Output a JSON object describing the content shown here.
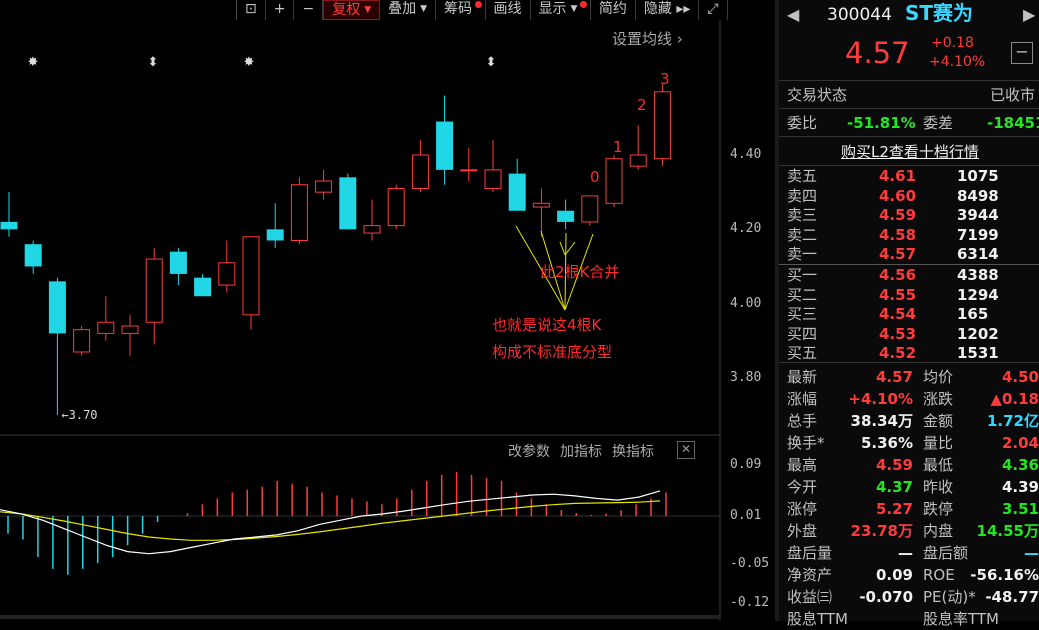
{
  "toolbar": {
    "items": [
      {
        "label": "复权",
        "active": true,
        "caret": true,
        "dot": false
      },
      {
        "label": "叠加",
        "active": false,
        "caret": true,
        "dot": false
      },
      {
        "label": "筹码",
        "active": false,
        "caret": false,
        "dot": true
      },
      {
        "label": "画线",
        "active": false,
        "caret": false,
        "dot": false
      },
      {
        "label": "显示",
        "active": false,
        "caret": true,
        "dot": true
      },
      {
        "label": "简约",
        "active": false,
        "caret": false,
        "dot": false
      },
      {
        "label": "隐藏",
        "active": false,
        "caret": false,
        "dot": false
      }
    ]
  },
  "chart": {
    "ma_setting": "设置均线",
    "price_labels": [
      "4.40",
      "4.20",
      "4.00",
      "3.80"
    ],
    "low_marker": "3.70",
    "indicator_labels": [
      "改参数",
      "加指标",
      "换指标"
    ],
    "indicator_axis": [
      "0.09",
      "0.01",
      "-0.05",
      "-0.12"
    ],
    "annotations": {
      "merge": "此2根K合并",
      "line1": "也就是说这4根K",
      "line2": "构成不标准底分型",
      "nums": [
        "0",
        "1",
        "2",
        "3"
      ]
    }
  },
  "chart_data": {
    "type": "candlestick",
    "ylim": [
      3.7,
      4.62
    ],
    "candles": [
      {
        "o": 4.22,
        "c": 4.2,
        "h": 4.3,
        "l": 4.18
      },
      {
        "o": 4.16,
        "c": 4.1,
        "h": 4.17,
        "l": 4.08
      },
      {
        "o": 4.06,
        "c": 3.92,
        "h": 4.07,
        "l": 3.7
      },
      {
        "o": 3.87,
        "c": 3.93,
        "h": 3.94,
        "l": 3.86
      },
      {
        "o": 3.92,
        "c": 3.95,
        "h": 4.02,
        "l": 3.9
      },
      {
        "o": 3.92,
        "c": 3.94,
        "h": 3.97,
        "l": 3.86
      },
      {
        "o": 3.95,
        "c": 4.12,
        "h": 4.15,
        "l": 3.89
      },
      {
        "o": 4.14,
        "c": 4.08,
        "h": 4.15,
        "l": 4.05
      },
      {
        "o": 4.07,
        "c": 4.02,
        "h": 4.08,
        "l": 4.02
      },
      {
        "o": 4.05,
        "c": 4.11,
        "h": 4.17,
        "l": 4.03
      },
      {
        "o": 3.97,
        "c": 4.18,
        "h": 4.18,
        "l": 3.93
      },
      {
        "o": 4.2,
        "c": 4.17,
        "h": 4.27,
        "l": 4.15
      },
      {
        "o": 4.17,
        "c": 4.32,
        "h": 4.34,
        "l": 4.16
      },
      {
        "o": 4.3,
        "c": 4.33,
        "h": 4.36,
        "l": 4.28
      },
      {
        "o": 4.34,
        "c": 4.2,
        "h": 4.35,
        "l": 4.2
      },
      {
        "o": 4.19,
        "c": 4.21,
        "h": 4.28,
        "l": 4.17
      },
      {
        "o": 4.21,
        "c": 4.31,
        "h": 4.32,
        "l": 4.2
      },
      {
        "o": 4.31,
        "c": 4.4,
        "h": 4.44,
        "l": 4.3
      },
      {
        "o": 4.49,
        "c": 4.36,
        "h": 4.56,
        "l": 4.32
      },
      {
        "o": 4.36,
        "c": 4.36,
        "h": 4.42,
        "l": 4.33
      },
      {
        "o": 4.31,
        "c": 4.36,
        "h": 4.44,
        "l": 4.3
      },
      {
        "o": 4.35,
        "c": 4.25,
        "h": 4.39,
        "l": 4.25
      },
      {
        "o": 4.26,
        "c": 4.27,
        "h": 4.31,
        "l": 4.18
      },
      {
        "o": 4.25,
        "c": 4.22,
        "h": 4.28,
        "l": 4.2
      },
      {
        "o": 4.22,
        "c": 4.29,
        "h": 4.29,
        "l": 4.21
      },
      {
        "o": 4.27,
        "c": 4.39,
        "h": 4.4,
        "l": 4.26
      },
      {
        "o": 4.37,
        "c": 4.4,
        "h": 4.48,
        "l": 4.36
      },
      {
        "o": 4.39,
        "c": 4.57,
        "h": 4.59,
        "l": 4.37
      }
    ],
    "macd_bars": [
      -0.03,
      -0.04,
      -0.07,
      -0.09,
      -0.1,
      -0.09,
      -0.08,
      -0.07,
      -0.05,
      -0.03,
      -0.01,
      0.0,
      0.005,
      0.02,
      0.03,
      0.04,
      0.045,
      0.05,
      0.06,
      0.055,
      0.05,
      0.04,
      0.035,
      0.03,
      0.025,
      0.02,
      0.03,
      0.045,
      0.06,
      0.07,
      0.075,
      0.07,
      0.065,
      0.06,
      0.04,
      0.03,
      0.02,
      0.01,
      0.005,
      0.002,
      0.004,
      0.01,
      0.02,
      0.03,
      0.04
    ],
    "dif": [
      0.015,
      0.005,
      -0.01,
      -0.03,
      -0.05,
      -0.07,
      -0.085,
      -0.09,
      -0.085,
      -0.075,
      -0.065,
      -0.055,
      -0.05,
      -0.045,
      -0.035,
      -0.02,
      -0.01,
      0.0,
      0.005,
      0.012,
      0.02,
      0.028,
      0.035,
      0.04,
      0.045,
      0.05,
      0.052,
      0.048,
      0.042,
      0.038,
      0.045,
      0.06
    ],
    "dea": [
      0.01,
      0.005,
      -0.003,
      -0.012,
      -0.022,
      -0.032,
      -0.042,
      -0.05,
      -0.055,
      -0.058,
      -0.058,
      -0.056,
      -0.053,
      -0.049,
      -0.044,
      -0.038,
      -0.031,
      -0.024,
      -0.017,
      -0.011,
      -0.005,
      0.001,
      0.007,
      0.013,
      0.018,
      0.023,
      0.027,
      0.03,
      0.031,
      0.032,
      0.033,
      0.036
    ]
  },
  "quote": {
    "code": "300044",
    "name": "ST赛为",
    "price": "4.57",
    "change": "+0.18",
    "change_pct": "+4.10%",
    "status_label": "交易状态",
    "status_value": "已收市",
    "weibi_label": "委比",
    "weibi_value": "-51.81%",
    "weicha_label": "委差",
    "weicha_value": "-18451",
    "l2_link": "购买L2查看十档行情",
    "asks": [
      {
        "label": "卖五",
        "price": "4.61",
        "vol": "1075"
      },
      {
        "label": "卖四",
        "price": "4.60",
        "vol": "8498"
      },
      {
        "label": "卖三",
        "price": "4.59",
        "vol": "3944"
      },
      {
        "label": "卖二",
        "price": "4.58",
        "vol": "7199"
      },
      {
        "label": "卖一",
        "price": "4.57",
        "vol": "6314"
      }
    ],
    "bids": [
      {
        "label": "买一",
        "price": "4.56",
        "vol": "4388"
      },
      {
        "label": "买二",
        "price": "4.55",
        "vol": "1294"
      },
      {
        "label": "买三",
        "price": "4.54",
        "vol": "165"
      },
      {
        "label": "买四",
        "price": "4.53",
        "vol": "1202"
      },
      {
        "label": "买五",
        "price": "4.52",
        "vol": "1531"
      }
    ],
    "stats": [
      {
        "l1": "最新",
        "v1": "4.57",
        "c1": "red",
        "l2": "均价",
        "v2": "4.50",
        "c2": "red"
      },
      {
        "l1": "涨幅",
        "v1": "+4.10%",
        "c1": "red",
        "l2": "涨跌",
        "v2": "▲0.18",
        "c2": "red"
      },
      {
        "l1": "总手",
        "v1": "38.34万",
        "c1": "white",
        "l2": "金额",
        "v2": "1.72亿",
        "c2": "cyan"
      },
      {
        "l1": "换手*",
        "v1": "5.36%",
        "c1": "white",
        "l2": "量比",
        "v2": "2.04",
        "c2": "red"
      },
      {
        "l1": "最高",
        "v1": "4.59",
        "c1": "red",
        "l2": "最低",
        "v2": "4.36",
        "c2": "green"
      },
      {
        "l1": "今开",
        "v1": "4.37",
        "c1": "green",
        "l2": "昨收",
        "v2": "4.39",
        "c2": "white"
      },
      {
        "l1": "涨停",
        "v1": "5.27",
        "c1": "red",
        "l2": "跌停",
        "v2": "3.51",
        "c2": "green"
      },
      {
        "l1": "外盘",
        "v1": "23.78万",
        "c1": "red",
        "l2": "内盘",
        "v2": "14.55万",
        "c2": "green"
      },
      {
        "l1": "盘后量",
        "v1": "—",
        "c1": "white",
        "l2": "盘后额",
        "v2": "—",
        "c2": "cyan"
      },
      {
        "l1": "净资产",
        "v1": "0.09",
        "c1": "white",
        "l2": "ROE",
        "v2": "-56.16%",
        "c2": "white"
      },
      {
        "l1": "收益㈢",
        "v1": "-0.070",
        "c1": "white",
        "l2": "PE(动)*",
        "v2": "-48.77",
        "c2": "white"
      },
      {
        "l1": "股息TTM",
        "v1": "",
        "c1": "white",
        "l2": "股息率TTM",
        "v2": "",
        "c2": "white"
      }
    ]
  }
}
